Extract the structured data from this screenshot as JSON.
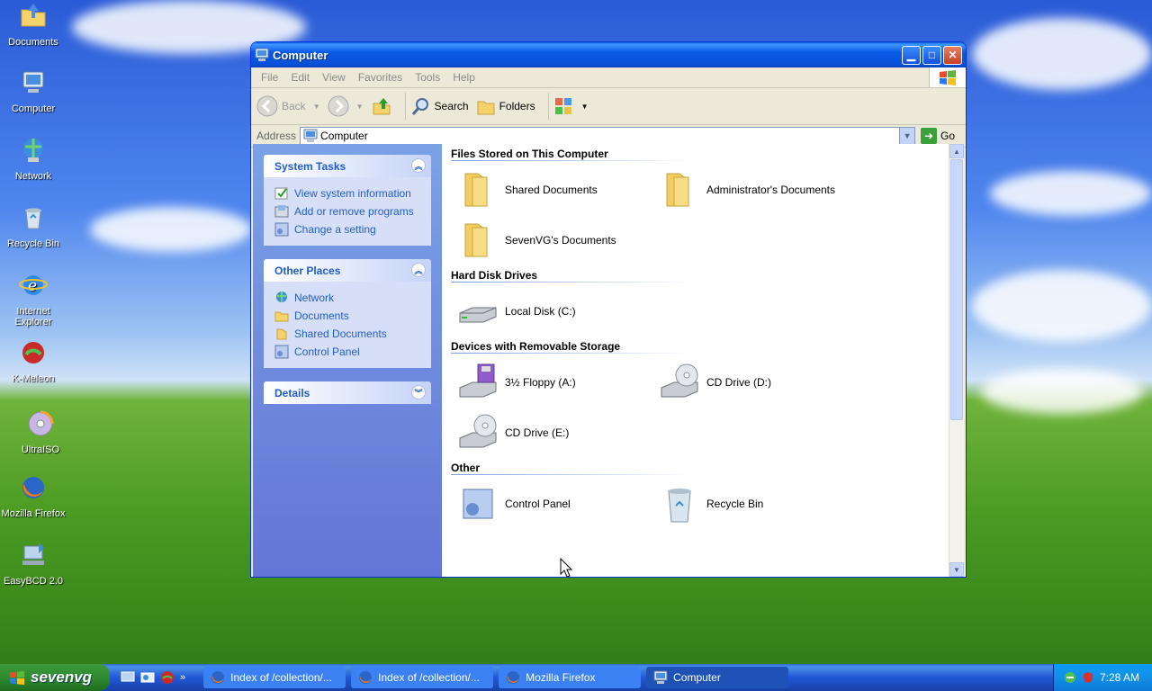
{
  "desktop": {
    "icons": [
      {
        "label": "Documents"
      },
      {
        "label": "Computer"
      },
      {
        "label": "Network"
      },
      {
        "label": "Recycle Bin"
      },
      {
        "label": "Internet Explorer"
      },
      {
        "label": "K-Meleon"
      },
      {
        "label": "UltraISO"
      },
      {
        "label": "Mozilla Firefox"
      },
      {
        "label": "EasyBCD 2.0"
      }
    ]
  },
  "window": {
    "title": "Computer",
    "menu": [
      "File",
      "Edit",
      "View",
      "Favorites",
      "Tools",
      "Help"
    ],
    "toolbar": {
      "back_label": "Back",
      "search_label": "Search",
      "folders_label": "Folders"
    },
    "address": {
      "label": "Address",
      "value": "Computer",
      "go_label": "Go"
    },
    "system_tasks": {
      "title": "System Tasks",
      "items": [
        "View system information",
        "Add or remove programs",
        "Change a setting"
      ]
    },
    "other_places": {
      "title": "Other Places",
      "items": [
        "Network",
        "Documents",
        "Shared Documents",
        "Control Panel"
      ]
    },
    "details": {
      "title": "Details"
    },
    "groups": {
      "files": {
        "title": "Files Stored on This Computer",
        "items": [
          "Shared Documents",
          "Administrator's Documents",
          "SevenVG's Documents"
        ]
      },
      "hdd": {
        "title": "Hard Disk Drives",
        "items": [
          "Local Disk (C:)"
        ]
      },
      "removable": {
        "title": "Devices with Removable Storage",
        "items": [
          "3½ Floppy (A:)",
          "CD Drive (D:)",
          "CD Drive (E:)"
        ]
      },
      "other": {
        "title": "Other",
        "items": [
          "Control Panel",
          "Recycle Bin"
        ]
      }
    }
  },
  "taskbar": {
    "start_label": "sevenvg",
    "tasks": [
      {
        "label": "Index of /collection/..."
      },
      {
        "label": "Index of /collection/..."
      },
      {
        "label": "Mozilla Firefox"
      },
      {
        "label": "Computer"
      }
    ],
    "overflow": "»",
    "clock": "7:28 AM"
  }
}
